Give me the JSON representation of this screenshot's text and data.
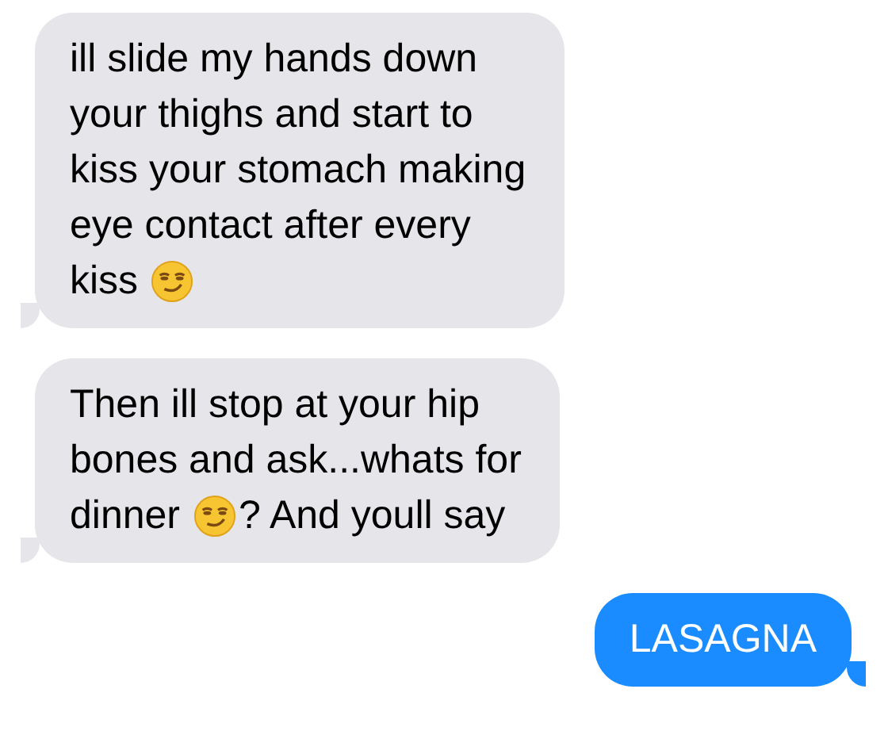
{
  "messages": [
    {
      "sent": false,
      "lines": [
        [
          {
            "kind": "text",
            "text": "ill slide my hands down"
          }
        ],
        [
          {
            "kind": "text",
            "text": "your thighs and start to"
          }
        ],
        [
          {
            "kind": "text",
            "text": "kiss your stomach making"
          }
        ],
        [
          {
            "kind": "text",
            "text": "eye contact after every"
          }
        ],
        [
          {
            "kind": "text",
            "text": "kiss"
          },
          {
            "kind": "emoji"
          }
        ]
      ]
    },
    {
      "sent": false,
      "lines": [
        [
          {
            "kind": "text",
            "text": "Then ill stop at your hip"
          }
        ],
        [
          {
            "kind": "text",
            "text": "bones and ask...whats for"
          }
        ],
        [
          {
            "kind": "text",
            "text": "dinner"
          },
          {
            "kind": "emoji"
          },
          {
            "kind": "text",
            "text": "? And youll say"
          }
        ]
      ]
    },
    {
      "sent": true,
      "lines": [
        [
          {
            "kind": "text",
            "text": "LASAGNA"
          }
        ]
      ]
    }
  ]
}
